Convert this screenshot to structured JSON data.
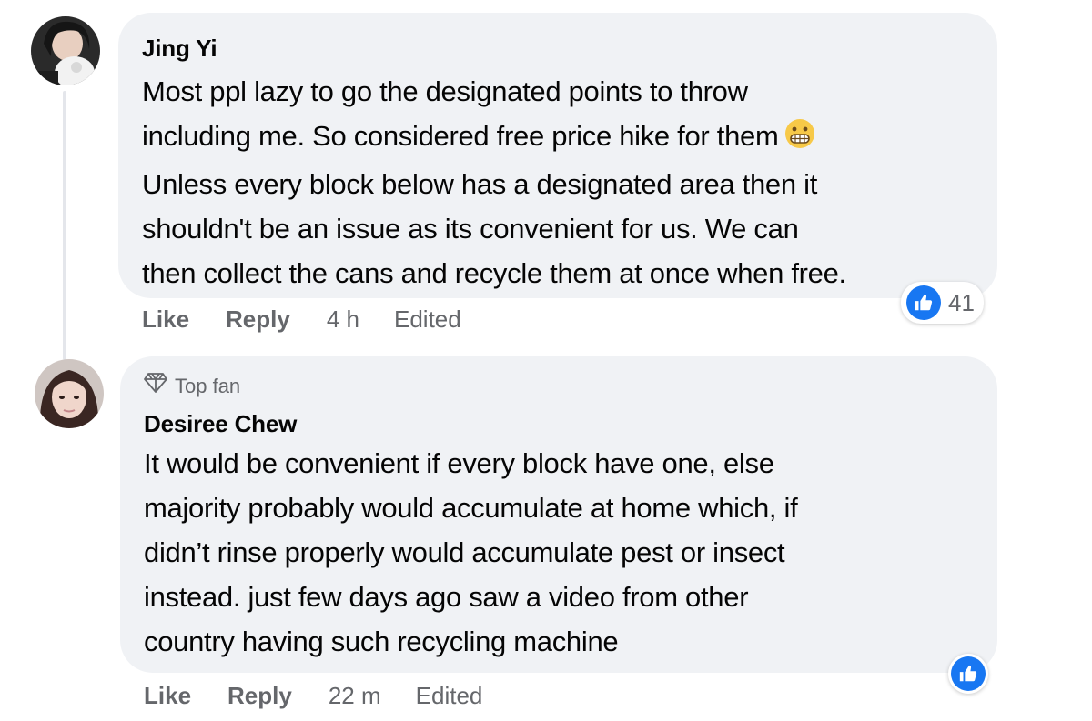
{
  "comments": [
    {
      "author": "Jing Yi",
      "lines": [
        "Most ppl lazy to go the designated points to throw",
        "including me. So considered free price hike for them",
        "Unless every block below has a designated area then it",
        "shouldn't be an issue as its convenient for us. We can",
        "then collect the cans and recycle them at once when free."
      ],
      "emoji": "grimacing-face",
      "like_label": "Like",
      "reply_label": "Reply",
      "time": "4 h",
      "edited_label": "Edited",
      "reaction_count": "41",
      "reaction_icon": "like-icon"
    },
    {
      "badge_label": "Top fan",
      "badge_icon": "diamond-icon",
      "author": "Desiree Chew",
      "lines": [
        "It would be convenient if every block have one, else",
        "majority probably would accumulate at home which, if",
        "didn’t rinse properly would accumulate pest or insect",
        "instead. just few days ago saw a video from other",
        "country having such recycling machine"
      ],
      "like_label": "Like",
      "reply_label": "Reply",
      "time": "22 m",
      "edited_label": "Edited",
      "reaction_icon": "like-icon"
    }
  ],
  "colors": {
    "bubble": "#f0f2f5",
    "text": "#050505",
    "secondary": "#65676b",
    "like_blue": "#1877f2",
    "thread_line": "#e4e6eb"
  }
}
